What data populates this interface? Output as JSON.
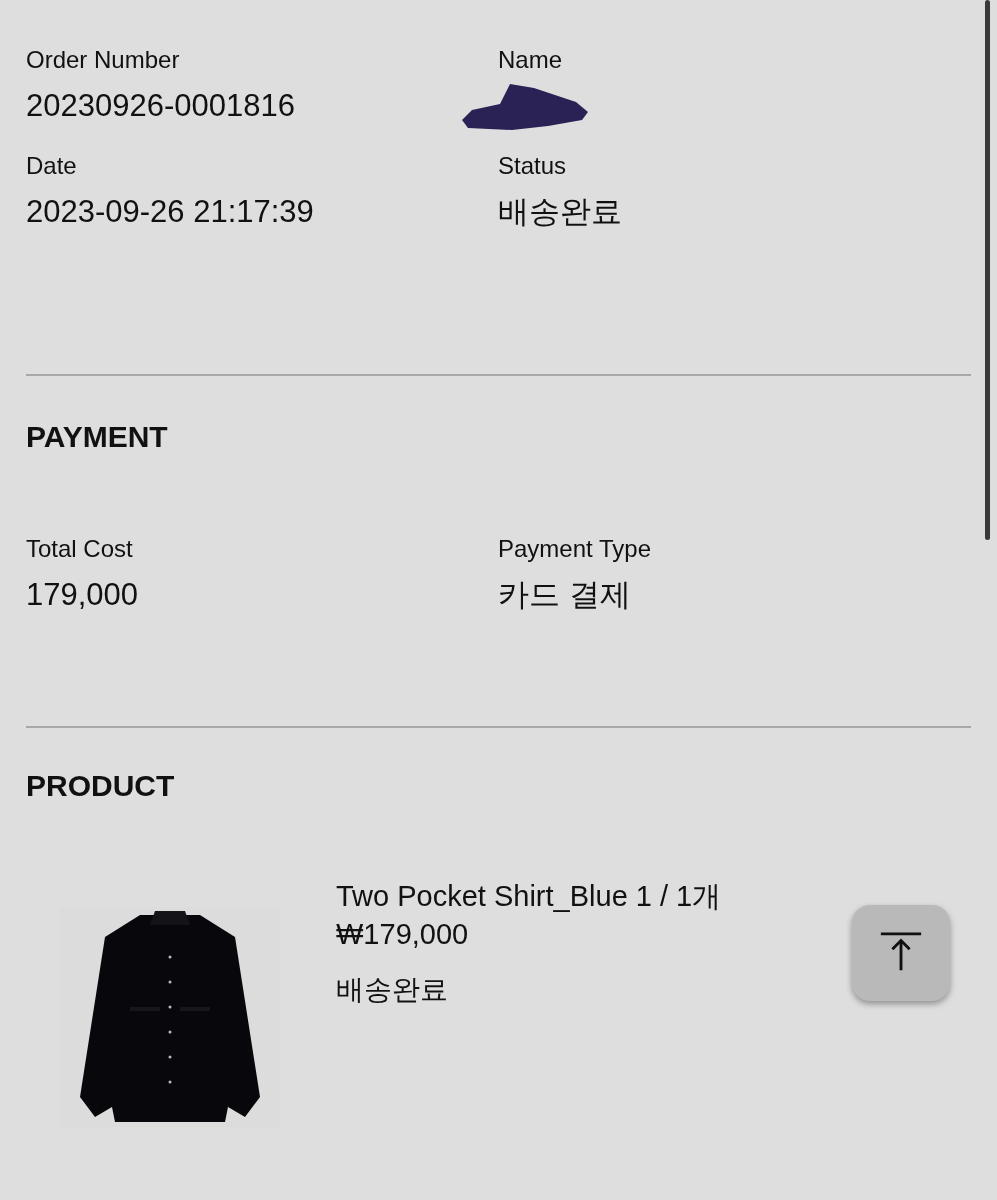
{
  "order": {
    "fields": [
      {
        "label": "Order Number",
        "value": "20230926-0001816"
      },
      {
        "label": "Name",
        "redacted": true
      },
      {
        "label": "Date",
        "value": "2023-09-26 21:17:39"
      },
      {
        "label": "Status",
        "value": "배송완료"
      }
    ]
  },
  "payment": {
    "heading": "PAYMENT",
    "fields": [
      {
        "label": "Total Cost",
        "value": "179,000"
      },
      {
        "label": "Payment Type",
        "value": "카드 결제"
      }
    ]
  },
  "product": {
    "heading": "PRODUCT",
    "items": [
      {
        "title": "Two Pocket Shirt_Blue 1 / 1개",
        "price": "₩179,000",
        "status": "배송완료"
      }
    ]
  }
}
